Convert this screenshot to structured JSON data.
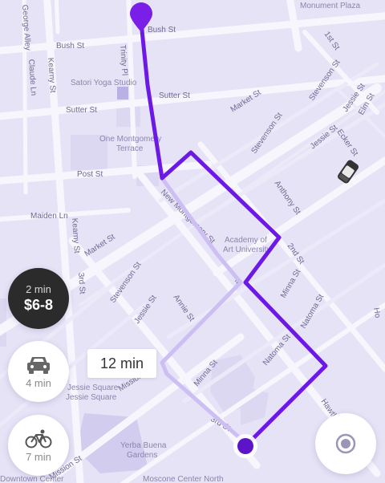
{
  "streets": {
    "bush": "Bush St",
    "bush_east": "Bush St",
    "sutter": "Sutter St",
    "sutter_east": "Sutter St",
    "post": "Post St",
    "maiden": "Maiden Ln",
    "market_west": "Market St",
    "market_east": "Market St",
    "kearny_top": "Kearny St",
    "kearny_bottom": "Kearny St",
    "third_left": "3rd St",
    "third_bottom": "3rd St",
    "stevenson_left": "Stevenson St",
    "stevenson_mid": "Stevenson St",
    "stevenson_right": "Stevenson St",
    "jessie_left": "Jessie St",
    "jessie_right": "Jessie St",
    "jessie_far": "Jessie St",
    "annie": "Annie St",
    "new_montgomery": "New Montgomery St",
    "anthony": "Anthony St",
    "second": "2nd St",
    "minna_center": "Minna St",
    "minna_right": "Minna St",
    "minna_bottom": "Minna St",
    "natoma_right": "Natoma St",
    "natoma_center": "Natoma St",
    "ecker": "Ecker St",
    "elm": "Elm St",
    "first": "1st St",
    "mission": "Mission",
    "mission_bottom": "Mission St",
    "trinity": "Trinity Pl",
    "claude": "Claude Ln",
    "george": "George Alley",
    "hawthorne": "Hawthor",
    "ho": "Ho",
    "montgomery_partial": "M"
  },
  "pois": {
    "monument_plaza": "Monument Plaza",
    "satori": "Satori Yoga Studio",
    "one_montgomery_1": "One Montgomery",
    "one_montgomery_2": "Terrace",
    "academy_1": "Academy of",
    "academy_2": "Art University",
    "jessie_square_1": "Jessie Square",
    "jessie_square_2": "Jessie Square",
    "yerba_1": "Yerba Buena",
    "yerba_2": "Gardens",
    "moscone": "Moscone Center North",
    "moscone_west": "Moscone Center",
    "downtown": "Downtown Center"
  },
  "trip": {
    "price_time": "2 min",
    "price_range": "$6-8",
    "car_time": "4 min",
    "bike_time": "7 min",
    "walk_duration": "12 min"
  },
  "colors": {
    "route": "#6c19e8",
    "route_alt": "#cdbff3",
    "map_bg": "#e6e3f6",
    "street": "#ffffff",
    "block": "#d8d3ef"
  },
  "icons": {
    "car": "car-icon",
    "bike": "bicycle-icon",
    "locate": "locate-icon",
    "pin": "map-pin-icon",
    "destination": "destination-dot-icon",
    "vehicle": "nearby-car-icon"
  }
}
